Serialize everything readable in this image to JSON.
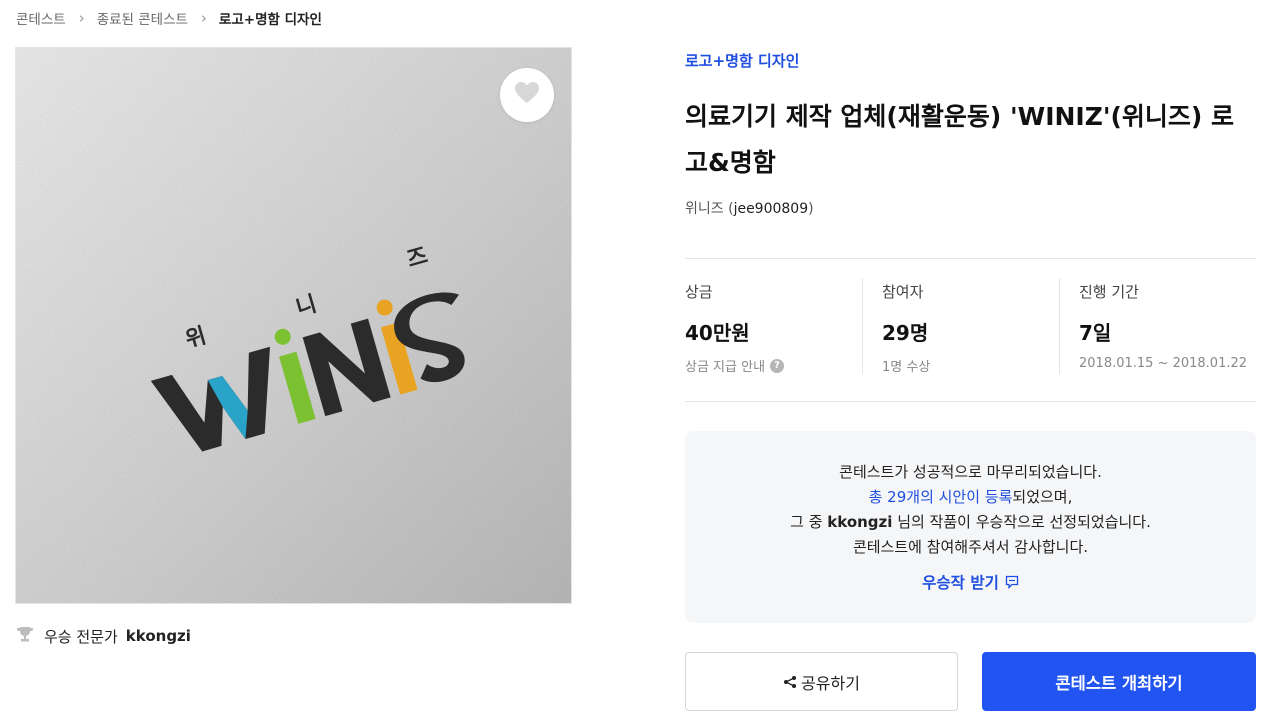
{
  "breadcrumb": [
    {
      "label": "콘테스트"
    },
    {
      "label": "종료된 콘테스트"
    },
    {
      "label": "로고+명함 디자인"
    }
  ],
  "image": {
    "logo_word": "WINIS",
    "logo_korean": [
      "위",
      "니",
      "즈"
    ],
    "colors": {
      "blue": "#2aa3c8",
      "green": "#7cc132",
      "orange": "#e7a321",
      "dark": "#2b2b2b",
      "paper": "#d0d0d0"
    }
  },
  "winner": {
    "label": "우승 전문가",
    "name": "kkongzi"
  },
  "contest": {
    "category": "로고+명함 디자인",
    "title": "의료기기 제작 업체(재활운동) 'WINIZ'(위니즈) 로고&명함",
    "host_name": "위니즈",
    "host_id_open": " (",
    "host_id": "jee900809",
    "host_id_close": ")"
  },
  "stats": {
    "prize": {
      "label": "상금",
      "value": "40만원",
      "sub": "상금 지급 안내"
    },
    "participants": {
      "label": "참여자",
      "value": "29명",
      "sub": "1명 수상"
    },
    "period": {
      "label": "진행 기간",
      "value": "7일",
      "sub": "2018.01.15 ~ 2018.01.22"
    }
  },
  "result": {
    "line1": "콘테스트가 성공적으로 마무리되었습니다.",
    "line2_highlight": "총 29개의 시안이 등록",
    "line2_rest": "되었으며,",
    "line3_pre": "그 중 ",
    "line3_name": "kkongzi",
    "line3_rest": " 님의 작품이 우승작으로 선정되었습니다.",
    "line4": "콘테스트에 참여해주셔서 감사합니다.",
    "receive_label": "우승작 받기"
  },
  "buttons": {
    "share": "공유하기",
    "host": "콘테스트 개최하기"
  },
  "icons": {
    "like": "heart-icon",
    "trophy": "trophy-icon",
    "help": "question-icon",
    "chat": "comment-icon",
    "share": "share-icon",
    "chevron": "chevron-right-icon"
  }
}
